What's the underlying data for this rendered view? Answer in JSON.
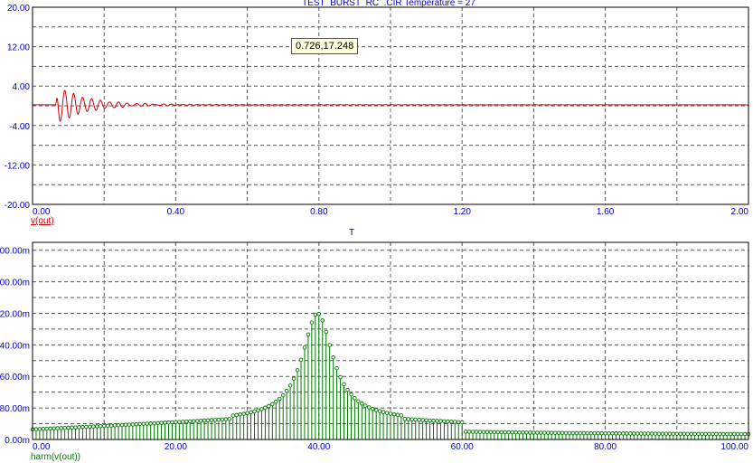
{
  "window": {
    "title": "TEST_BURST_RC_.CIR Temperature = 27"
  },
  "cursor_readout": "0.726,17.248",
  "chart_data": [
    {
      "type": "line",
      "title": "TEST_BURST_RC_.CIR Temperature = 27",
      "series_label": "v(out)",
      "color": "#cc0000",
      "xlim": [
        0,
        2.0
      ],
      "ylim": [
        -20,
        20
      ],
      "xticks": [
        0,
        0.4,
        0.8,
        1.2,
        1.6,
        2.0
      ],
      "xtick_labels": [
        "0.00",
        "0.40",
        "0.80",
        "1.20",
        "1.60",
        "2.00"
      ],
      "yticks": [
        20,
        12,
        4,
        -4,
        -12,
        -20
      ],
      "ytick_labels": [
        "20.00",
        "12.00",
        "4.00",
        "-4.00",
        "-12.00",
        "-20.00"
      ],
      "grid": true,
      "signal": {
        "baseline": 0.2,
        "start": 0.065,
        "peak": 4.2,
        "trough": -3.8,
        "freq_hz": 40,
        "decay_per_s": 12,
        "noise_until": 2.0,
        "noise_amp": 0.35
      }
    },
    {
      "type": "stem",
      "title": "T",
      "series_label": "harm(v(out))",
      "color": "#007700",
      "xlim": [
        0,
        100
      ],
      "ylim": [
        0,
        0.5
      ],
      "xticks": [
        0,
        20,
        40,
        60,
        80,
        100
      ],
      "xtick_labels": [
        "0.00",
        "20.00",
        "40.00",
        "60.00",
        "80.00",
        "100.00"
      ],
      "yticks": [
        0,
        0.08,
        0.16,
        0.24,
        0.32,
        0.4,
        0.48
      ],
      "ytick_labels": [
        "0.00m",
        "80.00m",
        "60.00m",
        "40.00m",
        "20.00m",
        "00.00m",
        "00.00m"
      ],
      "grid": true,
      "spectrum": {
        "center": 39.8,
        "peak": 0.268,
        "floor": 0.04,
        "step": 0.5,
        "width": 2.6
      }
    }
  ]
}
